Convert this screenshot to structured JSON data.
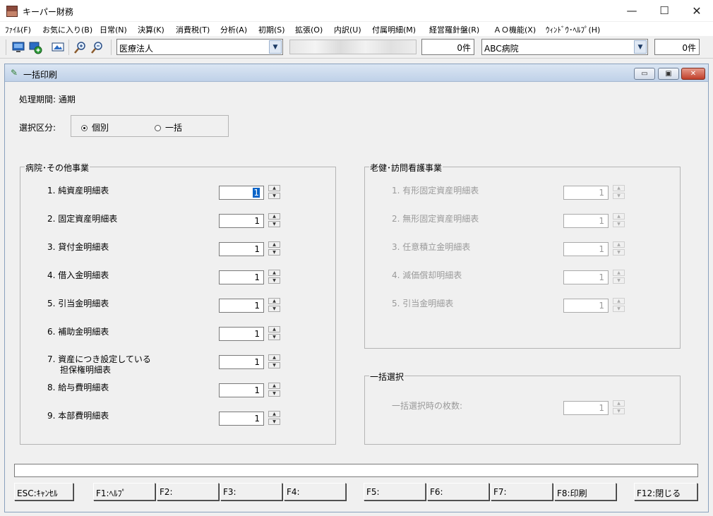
{
  "window": {
    "title": "キーパー財務",
    "min": "—",
    "max": "☐",
    "close": "✕"
  },
  "menu": [
    "ﾌｧｲﾙ(F)",
    "お気に入り(B)",
    "日常(N)",
    "決算(K)",
    "消費税(T)",
    "分析(A)",
    "初期(S)",
    "拡張(O)",
    "内訳(U)",
    "付属明細(M)",
    "経営羅針盤(R)",
    "ＡＯ機能(X)",
    "ｳｨﾝﾄﾞｳ･ﾍﾙﾌﾟ(H)"
  ],
  "toolbar": {
    "icons": [
      "monitor-icon",
      "refresh-icon",
      "screen-icon",
      "zoom-in-icon",
      "zoom-out-icon"
    ],
    "corp_type": "医療法人",
    "count1": "0件",
    "facility": "ABC病院",
    "count2": "0件"
  },
  "dialog": {
    "title": "一括印刷",
    "period_label": "処理期間: 通期",
    "selection_label": "選択区分:",
    "radio_individual": "個別",
    "radio_bulk": "一括",
    "selected_mode": "individual"
  },
  "hospital_group": {
    "title": "病院･その他事業",
    "items": [
      {
        "label": "1. 純資産明細表",
        "value": "1"
      },
      {
        "label": "2. 固定資産明細表",
        "value": "1"
      },
      {
        "label": "3. 貸付金明細表",
        "value": "1"
      },
      {
        "label": "4. 借入金明細表",
        "value": "1"
      },
      {
        "label": "5. 引当金明細表",
        "value": "1"
      },
      {
        "label": "6. 補助金明細表",
        "value": "1"
      },
      {
        "label": "7. 資産につき設定している",
        "label2": "担保権明細表",
        "value": "1"
      },
      {
        "label": "8. 給与費明細表",
        "value": "1"
      },
      {
        "label": "9. 本部費明細表",
        "value": "1"
      }
    ]
  },
  "elderly_group": {
    "title": "老健･訪問看護事業",
    "items": [
      {
        "label": "1. 有形固定資産明細表",
        "value": "1"
      },
      {
        "label": "2. 無形固定資産明細表",
        "value": "1"
      },
      {
        "label": "3. 任意積立金明細表",
        "value": "1"
      },
      {
        "label": "4. 減価償却明細表",
        "value": "1"
      },
      {
        "label": "5. 引当金明細表",
        "value": "1"
      }
    ]
  },
  "bulk_group": {
    "title": "一括選択",
    "label": "一括選択時の枚数:",
    "value": "1"
  },
  "fkeys": [
    {
      "key": "esc",
      "label": "ESC:ｷｬﾝｾﾙ"
    },
    {
      "key": "f1",
      "label": "F1:ﾍﾙﾌﾟ"
    },
    {
      "key": "f2",
      "label": "F2:"
    },
    {
      "key": "f3",
      "label": "F3:"
    },
    {
      "key": "f4",
      "label": "F4:"
    },
    {
      "key": "f5",
      "label": "F5:"
    },
    {
      "key": "f6",
      "label": "F6:"
    },
    {
      "key": "f7",
      "label": "F7:"
    },
    {
      "key": "f8",
      "label": "F8:印刷"
    },
    {
      "key": "f12",
      "label": "F12:閉じる"
    }
  ]
}
